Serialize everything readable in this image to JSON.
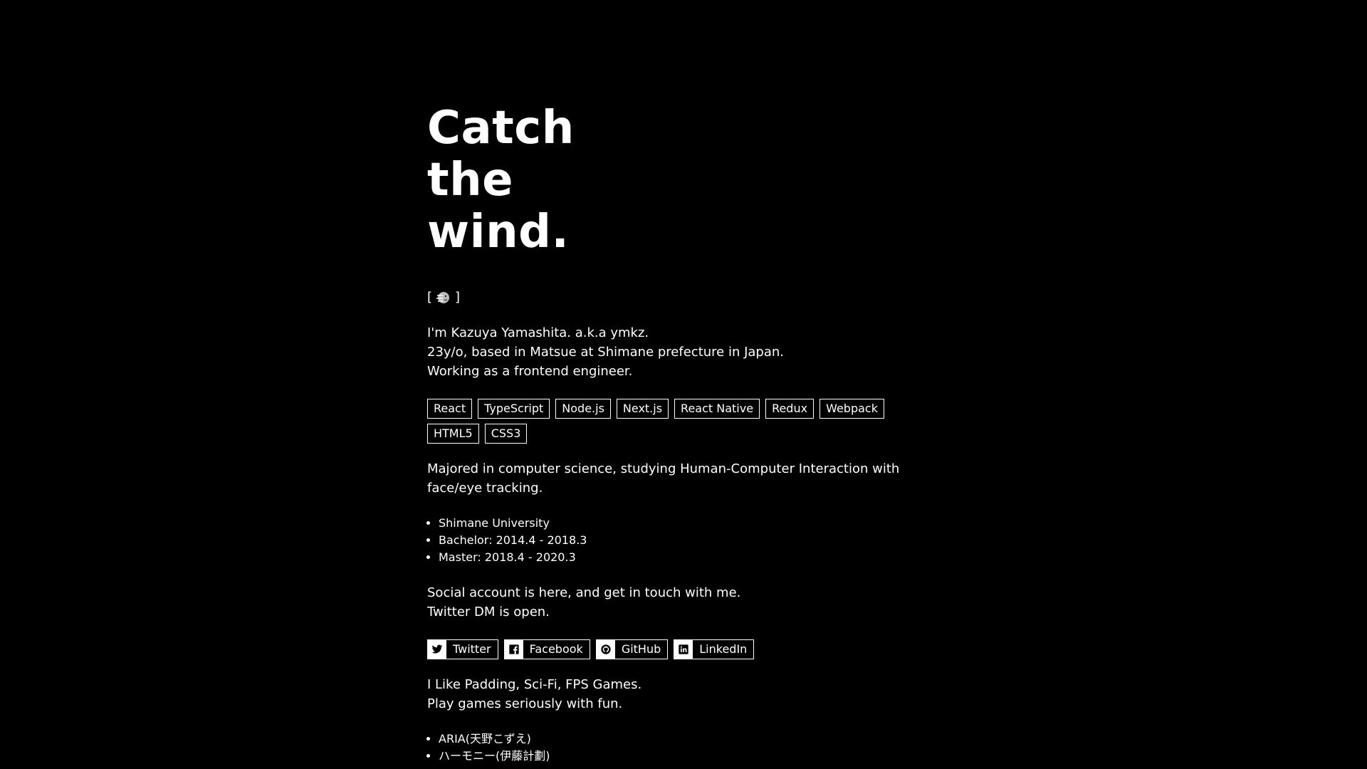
{
  "hero": {
    "lines": [
      "Catch",
      "the",
      "wind."
    ]
  },
  "emoji_line": {
    "open": "[",
    "close": "]",
    "icon": "wind-face-icon"
  },
  "intro": {
    "lines": [
      "I'm Kazuya Yamashita. a.k.a ymkz.",
      "23y/o, based in Matsue at Shimane prefecture in Japan.",
      "Working as a frontend engineer."
    ]
  },
  "skills": [
    "React",
    "TypeScript",
    "Node.js",
    "Next.js",
    "React Native",
    "Redux",
    "Webpack",
    "HTML5",
    "CSS3"
  ],
  "education": {
    "lines": [
      "Majored in computer science, studying Human-Computer Interaction with",
      "face/eye tracking."
    ],
    "items": [
      "Shimane University",
      "Bachelor: 2014.4 - 2018.3",
      "Master: 2018.4 - 2020.3"
    ]
  },
  "social": {
    "lines": [
      "Social account is here, and get in touch with me.",
      "Twitter DM is open."
    ],
    "links": [
      {
        "label": "Twitter",
        "icon": "twitter-icon"
      },
      {
        "label": "Facebook",
        "icon": "facebook-icon"
      },
      {
        "label": "GitHub",
        "icon": "github-icon"
      },
      {
        "label": "LinkedIn",
        "icon": "linkedin-icon"
      }
    ]
  },
  "likes": {
    "lines": [
      "I Like Padding, Sci-Fi, FPS Games.",
      "Play games seriously with fun."
    ],
    "items": [
      "ARIA(天野こずえ)",
      "ハーモニー(伊藤計劃)"
    ]
  }
}
